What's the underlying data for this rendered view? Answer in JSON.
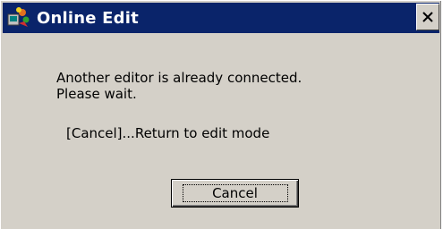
{
  "window": {
    "title": "Online Edit",
    "icon": "online-edit-app-icon",
    "close_icon": "close-icon"
  },
  "dialog": {
    "message_line1": "Another editor is already connected.",
    "message_line2": "Please wait.",
    "hint": "[Cancel]...Return to edit mode",
    "cancel_label": "Cancel"
  },
  "colors": {
    "titlebar": "#0a246a",
    "face": "#d4d0c8"
  }
}
